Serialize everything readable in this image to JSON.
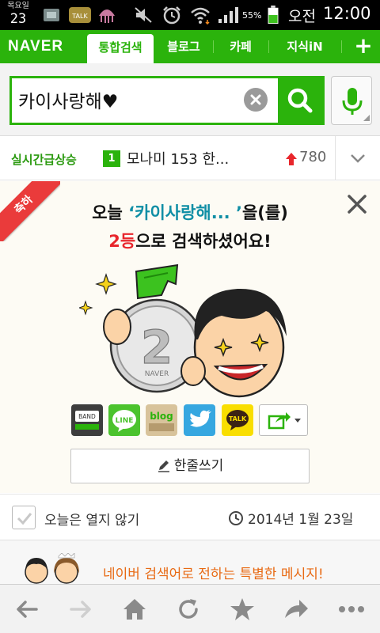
{
  "status_bar": {
    "date_top": "목요일",
    "date_day": "23",
    "battery_percent": "55%",
    "ampm": "오전",
    "time": "12:00",
    "icons": [
      "usb-icon",
      "kakaotalk-icon",
      "jellyfish-icon",
      "mute-icon",
      "alarm-icon",
      "wifi-icon",
      "signal-icon",
      "battery-icon"
    ]
  },
  "nav": {
    "logo": "NAVER",
    "tabs": [
      {
        "label": "통합검색",
        "active": true
      },
      {
        "label": "블로그",
        "active": false
      },
      {
        "label": "카페",
        "active": false
      },
      {
        "label": "지식iN",
        "active": false
      }
    ],
    "plus": "+"
  },
  "search": {
    "query": "카이사랑해♥"
  },
  "realtime": {
    "label": "실시간급상승",
    "rank": "1",
    "query": "모나미 153 한...",
    "count": "780"
  },
  "congrats": {
    "ribbon": "축하",
    "line1_prefix": "오늘 ",
    "line1_keyword": "‘카이사랑해... ’",
    "line1_suffix": "을(를)",
    "line2_rank": "2등",
    "line2_suffix": "으로 검색하셨어요!",
    "coin_number": "2",
    "coin_brand": "NAVER",
    "share_labels": {
      "band": "BAND",
      "line": "LINE",
      "blog": "blog",
      "talk": "TALK"
    },
    "oneline_button": "한줄쓰기"
  },
  "footer_row": {
    "dont_show_label": "오늘은 열지 않기",
    "date": "2014년 1월 23일"
  },
  "special": {
    "text": "네이버 검색어로 전하는 특별한 메시지!"
  },
  "colors": {
    "naver_green": "#2bb30c",
    "keyword_teal": "#0f8ea5",
    "rank_red": "#e8262c",
    "special_orange": "#e86a14"
  }
}
